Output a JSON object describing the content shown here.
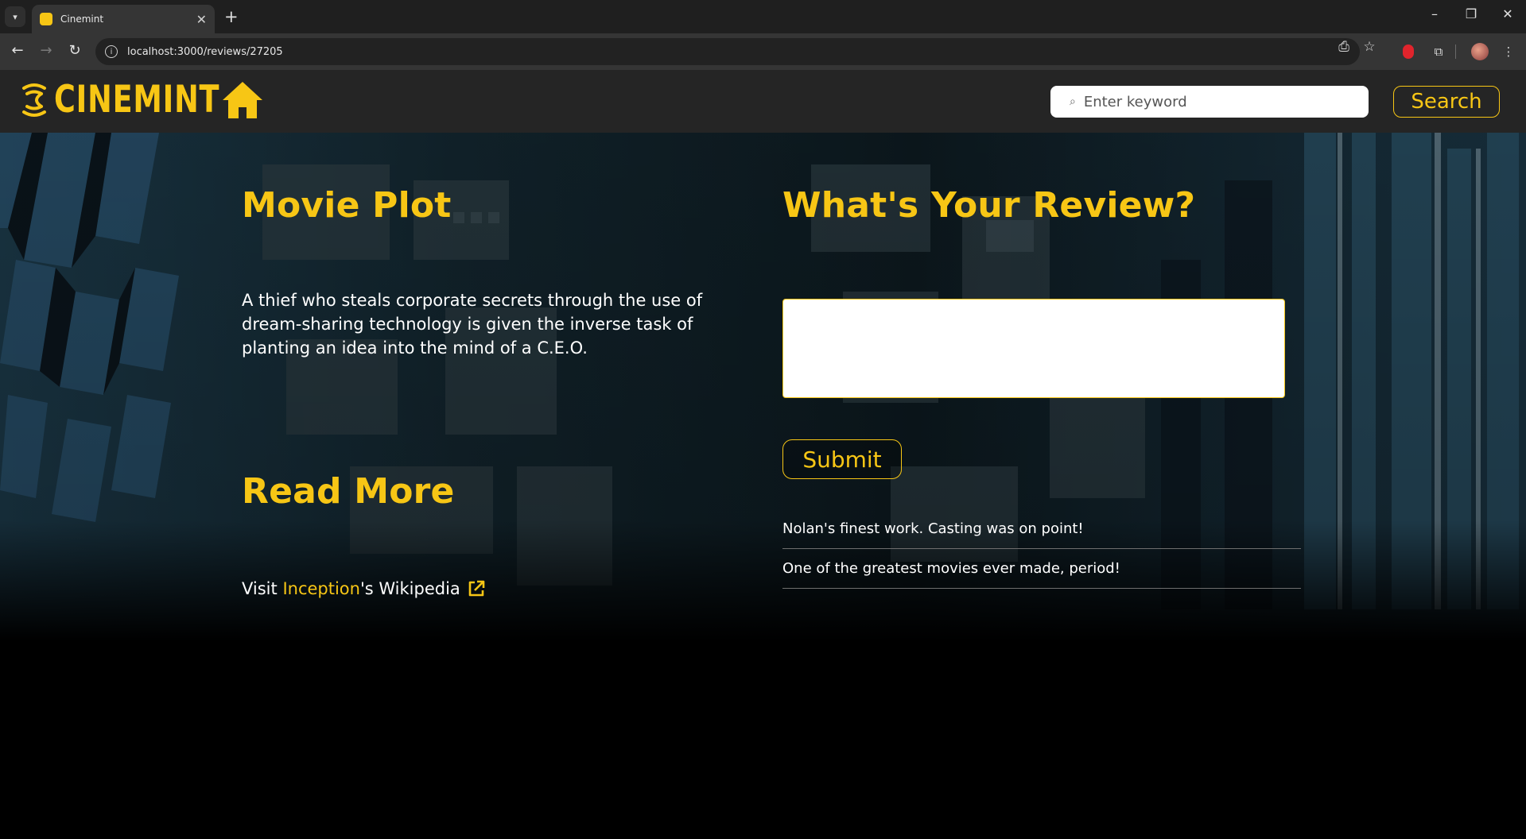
{
  "browser": {
    "tab_title": "Cinemint",
    "url": "localhost:3000/reviews/27205",
    "new_tab_symbol": "+",
    "close_symbol": "✕"
  },
  "header": {
    "brand": "CINEMINT",
    "search_placeholder": "Enter keyword",
    "search_button": "Search",
    "search_icon": "⌕"
  },
  "plot": {
    "heading": "Movie Plot",
    "text": "A thief who steals corporate secrets through the use of dream-sharing technology is given the inverse task of planting an idea into the mind of a C.E.O."
  },
  "read_more": {
    "heading": "Read More",
    "prefix": "Visit ",
    "movie_link": "Inception",
    "suffix": "'s Wikipedia"
  },
  "review_form": {
    "heading": "What's Your Review?",
    "textarea_value": "",
    "submit_label": "Submit"
  },
  "reviews": [
    "Nolan's finest work. Casting was on point!",
    "One of the greatest movies ever made, period!"
  ],
  "colors": {
    "accent": "#f7c615",
    "header_bg": "#252525",
    "page_bg": "#000000"
  },
  "icons": {
    "home": "home-icon",
    "external_link": "external-link-icon",
    "logo": "cinemint-logo-icon"
  }
}
